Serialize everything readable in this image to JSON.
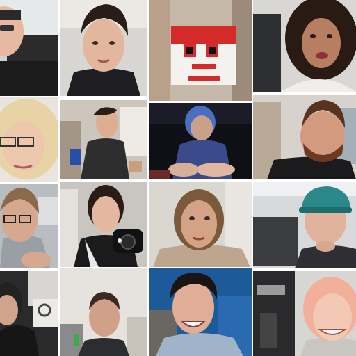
{
  "image": {
    "kind": "collage",
    "description_hidden": true,
    "grid": {
      "columns": 4,
      "rows": 4
    },
    "tiles": [
      {
        "subject": "person-with-glasses-at-desk",
        "accent": "#1b1b1b"
      },
      {
        "subject": "young-man-dark-hair",
        "accent": "#6b5a52"
      },
      {
        "subject": "red-white-box-mask",
        "accent": "#d42a2a"
      },
      {
        "subject": "woman-curly-hair",
        "accent": "#2a1a14"
      },
      {
        "subject": "blonde-person-glasses",
        "accent": "#e2cc9a"
      },
      {
        "subject": "person-holding-can",
        "accent": "#2e2e2e"
      },
      {
        "subject": "person-dark-room",
        "accent": "#3a4a8a"
      },
      {
        "subject": "bearded-man-black-shirt",
        "accent": "#6a3a22"
      },
      {
        "subject": "person-glasses-grey-hoodie",
        "accent": "#8a6a4a"
      },
      {
        "subject": "person-holding-camera",
        "accent": "#111111"
      },
      {
        "subject": "woman-brown-hair",
        "accent": "#7a5a3a"
      },
      {
        "subject": "person-teal-cap",
        "accent": "#2a8a8a"
      },
      {
        "subject": "person-black-hair-dark-room",
        "accent": "#222222"
      },
      {
        "subject": "young-man-white-room",
        "accent": "#3a2a22"
      },
      {
        "subject": "smiling-man-blue-room",
        "accent": "#1c5a9a"
      },
      {
        "subject": "pink-hair-person",
        "accent": "#f2b09a"
      }
    ]
  }
}
